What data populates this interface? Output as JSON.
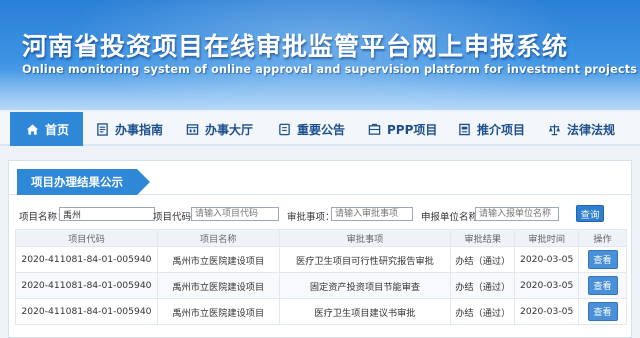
{
  "header": {
    "title": "河南省投资项目在线审批监管平台网上申报系统",
    "subtitle": "Online monitoring system of online approval and supervision platform for investment projects in Henan"
  },
  "nav": {
    "items": [
      {
        "label": "首页",
        "icon": "home-icon"
      },
      {
        "label": "办事指南",
        "icon": "guide-icon"
      },
      {
        "label": "办事大厅",
        "icon": "hall-icon"
      },
      {
        "label": "重要公告",
        "icon": "announcement-icon"
      },
      {
        "label": "PPP项目",
        "icon": "ppp-icon"
      },
      {
        "label": "推介项目",
        "icon": "promote-icon"
      },
      {
        "label": "法律法规",
        "icon": "law-icon"
      }
    ]
  },
  "panel": {
    "title": "项目办理结果公示"
  },
  "search": {
    "name_label": "项目名称：",
    "name_value": "禹州",
    "code_label": "项目代码：",
    "code_placeholder": "请输入项目代码",
    "matter_label": "审批事项：",
    "matter_placeholder": "请输入审批事项",
    "unit_label": "申报单位名称：",
    "unit_placeholder": "请输入报单位名称",
    "button_label": "查询"
  },
  "table": {
    "headers": [
      "项目代码",
      "项目名称",
      "审批事项",
      "审批结果",
      "审批时间",
      "操作"
    ],
    "rows": [
      {
        "code": "2020-411081-84-01-005940",
        "name": "禹州市立医院建设项目",
        "matter": "医疗卫生项目可行性研究报告审批",
        "result": "办结（通过）",
        "date": "2020-03-05",
        "action": "查看"
      },
      {
        "code": "2020-411081-84-01-005940",
        "name": "禹州市立医院建设项目",
        "matter": "固定资产投资项目节能审查",
        "result": "办结（通过）",
        "date": "2020-03-05",
        "action": "查看"
      },
      {
        "code": "2020-411081-84-01-005940",
        "name": "禹州市立医院建设项目",
        "matter": "医疗卫生项目建议书审批",
        "result": "办结（通过）",
        "date": "2020-03-05",
        "action": "查看"
      }
    ]
  },
  "colors": {
    "banner": "#2a7fd6",
    "nav_active": "#2f87d8",
    "nav_text": "#1d4f8c",
    "button": "#4a90d9"
  }
}
